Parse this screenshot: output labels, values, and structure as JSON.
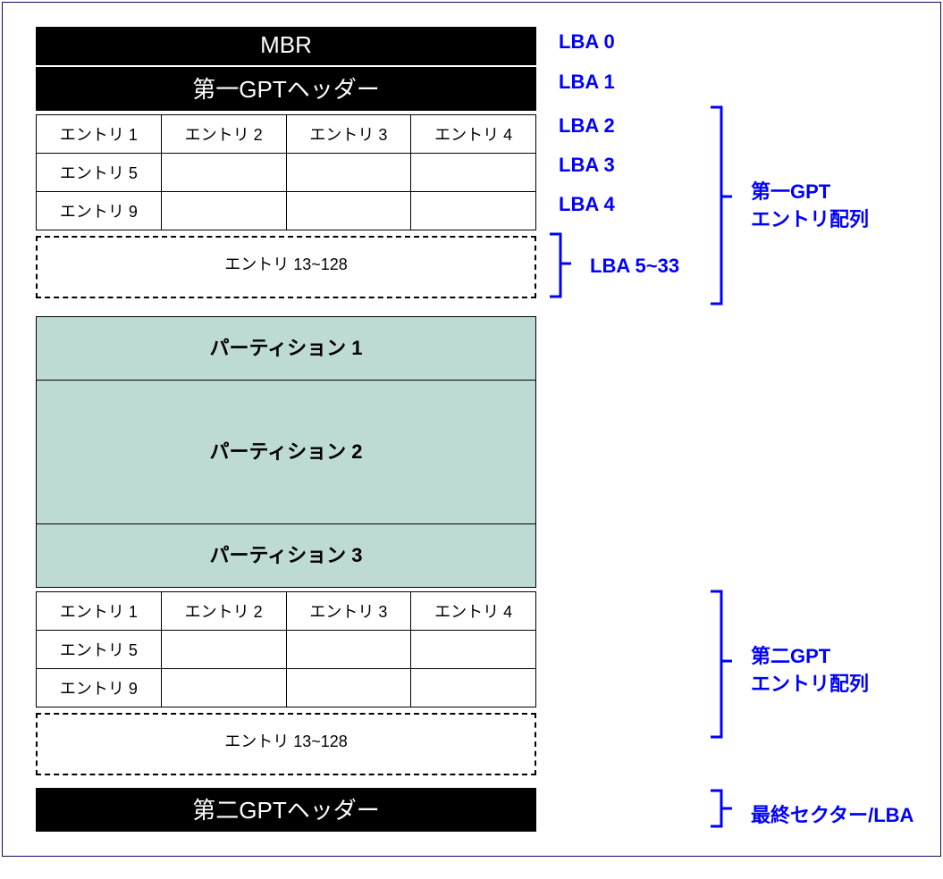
{
  "header_mbr": "MBR",
  "header_gpt1": "第一GPTヘッダー",
  "header_gpt2": "第二GPTヘッダー",
  "entries_row1": [
    "エントリ 1",
    "エントリ 2",
    "エントリ 3",
    "エントリ 4"
  ],
  "entries_row2": "エントリ 5",
  "entries_row3": "エントリ 9",
  "entries_rest": "エントリ 13~128",
  "partition1": "パーティション 1",
  "partition2": "パーティション 2",
  "partition3": "パーティション 3",
  "lba": [
    "LBA 0",
    "LBA 1",
    "LBA 2",
    "LBA 3",
    "LBA 4",
    "LBA 5~33"
  ],
  "label_gpt1_arr": "第一GPT\nエントリ配列",
  "label_gpt2_arr": "第二GPT\nエントリ配列",
  "label_last": "最終セクター/LBA"
}
